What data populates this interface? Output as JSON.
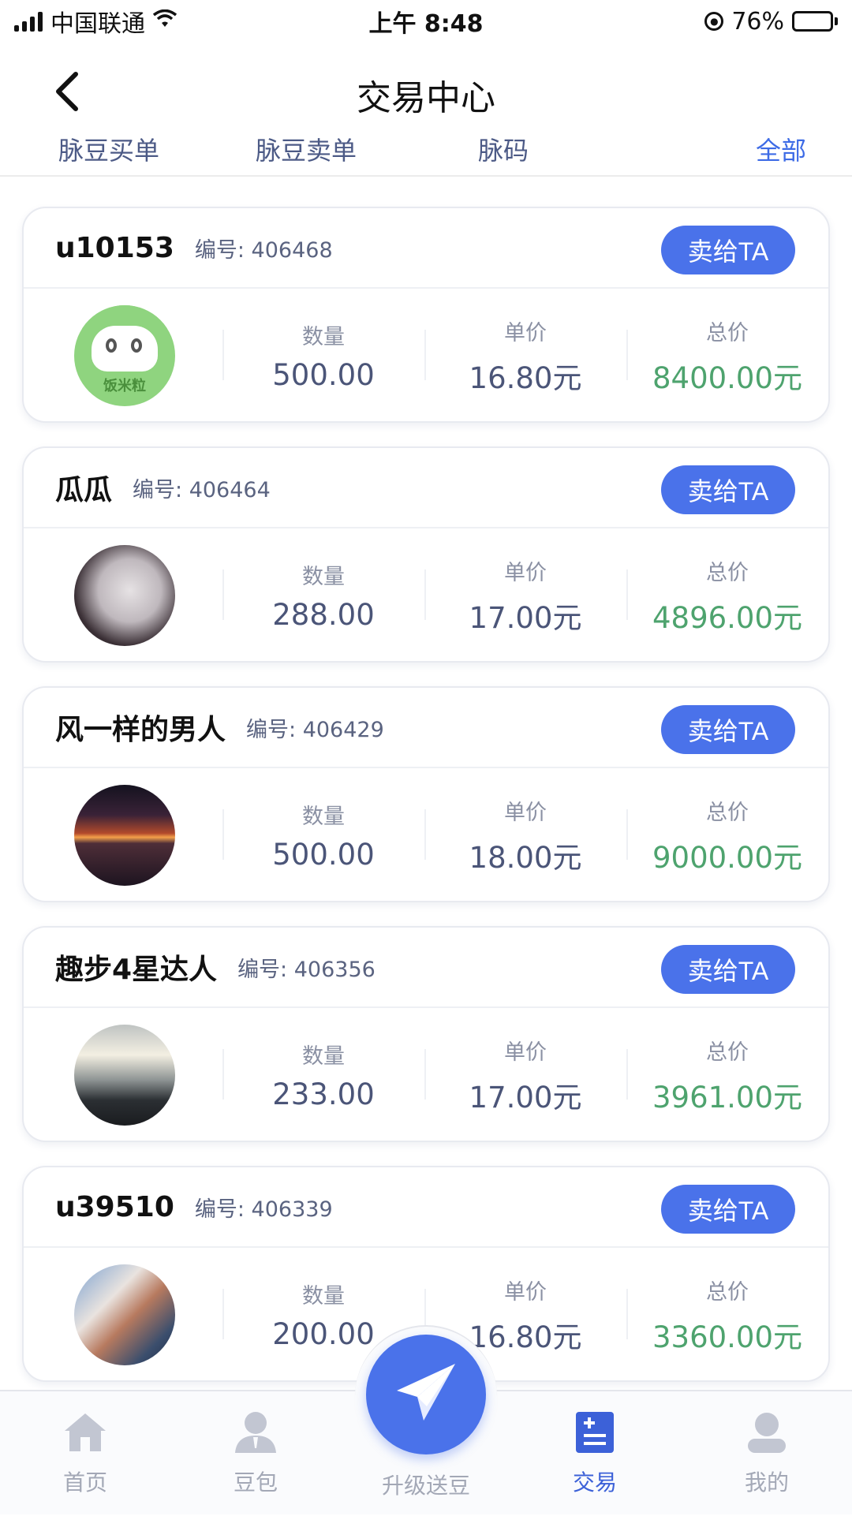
{
  "status_bar": {
    "carrier": "中国联通",
    "time": "上午 8:48",
    "battery_percent": "76%",
    "battery_level": 0.76
  },
  "nav": {
    "title": "交易中心"
  },
  "filters": {
    "tabs": [
      {
        "label": "脉豆买单"
      },
      {
        "label": "脉豆卖单"
      },
      {
        "label": "脉码"
      },
      {
        "label": "全部"
      }
    ]
  },
  "labels": {
    "number_prefix": "编号: ",
    "quantity": "数量",
    "unit_price": "单价",
    "total_price": "总价",
    "sell_button": "卖给TA"
  },
  "avatar_logo_text": "饭米粒",
  "orders": [
    {
      "name": "u10153",
      "no": "编号: 406468",
      "quantity": "500.00",
      "price": "16.80元",
      "total": "8400.00元",
      "avatar": "logo-cat"
    },
    {
      "name": "瓜瓜",
      "no": "编号: 406464",
      "quantity": "288.00",
      "price": "17.00元",
      "total": "4896.00元",
      "avatar": "photo-girl"
    },
    {
      "name": "风一样的男人",
      "no": "编号: 406429",
      "quantity": "500.00",
      "price": "18.00元",
      "total": "9000.00元",
      "avatar": "photo-sunset"
    },
    {
      "name": "趣步4星达人",
      "no": "编号: 406356",
      "quantity": "233.00",
      "price": "17.00元",
      "total": "3961.00元",
      "avatar": "photo-harbor"
    },
    {
      "name": "u39510",
      "no": "编号: 406339",
      "quantity": "200.00",
      "price": "16.80元",
      "total": "3360.00元",
      "avatar": "photo-person"
    }
  ],
  "tab_bar": {
    "items": [
      {
        "label": "首页",
        "icon": "home-icon"
      },
      {
        "label": "豆包",
        "icon": "user-icon"
      },
      {
        "label": "升级送豆",
        "icon": "paper-plane-icon"
      },
      {
        "label": "交易",
        "icon": "trade-icon"
      },
      {
        "label": "我的",
        "icon": "profile-icon"
      }
    ],
    "active_index": 3
  },
  "colors": {
    "accent": "#4a72ea",
    "total_green": "#4ea36e",
    "value_text": "#4b5578"
  }
}
